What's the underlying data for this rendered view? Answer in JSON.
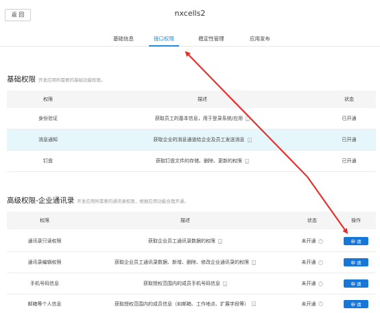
{
  "header": {
    "back_label": "返 回",
    "title": "nxcells2",
    "tabs": [
      {
        "label": "基础信息",
        "active": false
      },
      {
        "label": "接口权限",
        "active": true
      },
      {
        "label": "稳定性管理",
        "active": false
      },
      {
        "label": "应用发布",
        "active": false
      }
    ]
  },
  "basic": {
    "title": "基础权限",
    "desc": "开发应用所需要的基础功能权限。",
    "columns": [
      "权限",
      "描述",
      "状态"
    ],
    "rows": [
      {
        "name": "身份验证",
        "desc": "获取员工的基本信息，用于登录系统/应用",
        "status": "已开通",
        "highlighted": false
      },
      {
        "name": "消息通知",
        "desc": "获取企业的消息通道给企业及员工发送消息",
        "status": "已开通",
        "highlighted": true
      },
      {
        "name": "钉盘",
        "desc": "获取钉盘文件的存储、删除、更新的权限",
        "status": "已开通",
        "highlighted": false
      }
    ]
  },
  "advanced": {
    "title": "高级权限-企业通讯录",
    "desc": "开发应用所需要的通讯录权限，根据应用功能合理开通。",
    "columns": [
      "权限",
      "描述",
      "状态",
      "操作"
    ],
    "rows": [
      {
        "name": "通讯录只读权限",
        "desc": "获取企业员工通讯录数据的权限",
        "status": "未开通",
        "action": "申 请"
      },
      {
        "name": "通讯录编辑权限",
        "desc": "获取企业员工通讯录数据、新增、删除、修改企业通讯录的权限",
        "status": "未开通",
        "action": "申 请"
      },
      {
        "name": "手机号码信息",
        "desc": "获取授权范围内的成员手机号码信息",
        "status": "未开通",
        "action": "申 请"
      },
      {
        "name": "邮箱等个人信息",
        "desc": "获取授权范围内的成员信息（如邮箱、工作地点、扩展字段等）",
        "status": "未开通",
        "action": "申 请"
      }
    ]
  },
  "colors": {
    "accent": "#1a8be6",
    "button": "#1677d8",
    "arrow": "#e8302a",
    "highlight_row": "#e6f7fb"
  }
}
